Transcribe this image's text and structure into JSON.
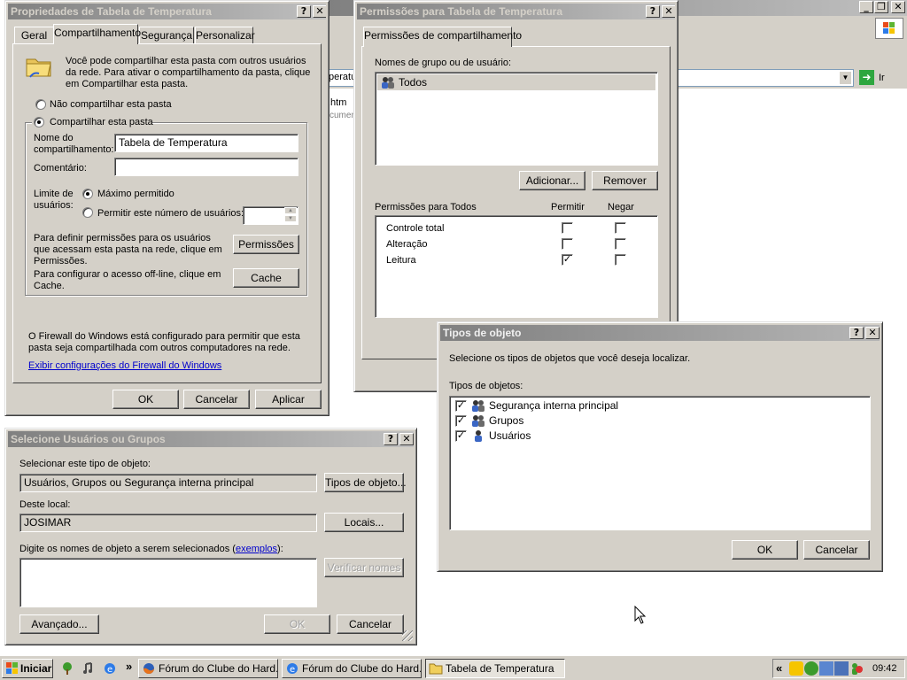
{
  "background_window": {
    "title": "",
    "address_fragment": "peratu",
    "file_fragment": ".htm",
    "file_sub_fragment": "cumen",
    "go_label": "Ir"
  },
  "props_dialog": {
    "title": "Propriedades de Tabela de Temperatura",
    "tabs": [
      {
        "label": "Geral"
      },
      {
        "label": "Compartilhamento"
      },
      {
        "label": "Segurança"
      },
      {
        "label": "Personalizar"
      }
    ],
    "intro_text": "Você pode compartilhar esta pasta com outros usuários da rede. Para ativar o compartilhamento da pasta, clique em Compartilhar esta pasta.",
    "no_share_label": "Não compartilhar esta pasta",
    "share_label": "Compartilhar esta pasta",
    "share_name_label": "Nome do compartilhamento:",
    "share_name_value": "Tabela de Temperatura",
    "comment_label": "Comentário:",
    "comment_value": "",
    "user_limit_label": "Limite de usuários:",
    "max_allowed_label": "Máximo permitido",
    "allow_number_label": "Permitir este número de usuários:",
    "permissions_text": "Para definir permissões para os usuários que acessam esta pasta na rede, clique em Permissões.",
    "permissions_button": "Permissões",
    "cache_text": "Para configurar o acesso off-line, clique em Cache.",
    "cache_button": "Cache",
    "firewall_text": "O Firewall do Windows está configurado para permitir que esta pasta seja compartilhada com outros computadores na rede.",
    "firewall_link": "Exibir configurações do Firewall do Windows",
    "ok": "OK",
    "cancel": "Cancelar",
    "apply": "Aplicar"
  },
  "perm_dialog": {
    "title": "Permissões para Tabela de Temperatura",
    "tab": "Permissões de compartilhamento",
    "groups_label": "Nomes de grupo ou de usuário:",
    "groups": [
      {
        "name": "Todos"
      }
    ],
    "add_button": "Adicionar...",
    "remove_button": "Remover",
    "perms_for_label": "Permissões para Todos",
    "allow_header": "Permitir",
    "deny_header": "Negar",
    "permissions": [
      {
        "name": "Controle total",
        "allow": false,
        "deny": false
      },
      {
        "name": "Alteração",
        "allow": false,
        "deny": false
      },
      {
        "name": "Leitura",
        "allow": true,
        "deny": false
      }
    ]
  },
  "select_dialog": {
    "title": "Selecione Usuários ou Grupos",
    "object_type_label": "Selecionar este tipo de objeto:",
    "object_type_value": "Usuários, Grupos ou Segurança interna principal",
    "object_types_button": "Tipos de objeto...",
    "location_label": "Deste local:",
    "location_value": "JOSIMAR",
    "locations_button": "Locais...",
    "names_label_pre": "Digite os nomes de objeto a serem selecionados (",
    "names_label_link": "exemplos",
    "names_label_post": "):",
    "check_names_button": "Verificar nomes",
    "advanced_button": "Avançado...",
    "ok": "OK",
    "cancel": "Cancelar"
  },
  "types_dialog": {
    "title": "Tipos de objeto",
    "instruction": "Selecione os tipos de objetos que você deseja localizar.",
    "list_label": "Tipos de objetos:",
    "items": [
      {
        "label": "Segurança interna principal",
        "checked": true
      },
      {
        "label": "Grupos",
        "checked": true
      },
      {
        "label": "Usuários",
        "checked": true
      }
    ],
    "ok": "OK",
    "cancel": "Cancelar"
  },
  "taskbar": {
    "start_label": "Iniciar",
    "chevron": "»",
    "tasks": [
      {
        "label": "Fórum do Clube do Hard..."
      },
      {
        "label": "Fórum do Clube do Hard..."
      },
      {
        "label": "Tabela de Temperatura"
      }
    ],
    "tray_chevron": "«",
    "clock": "09:42"
  }
}
